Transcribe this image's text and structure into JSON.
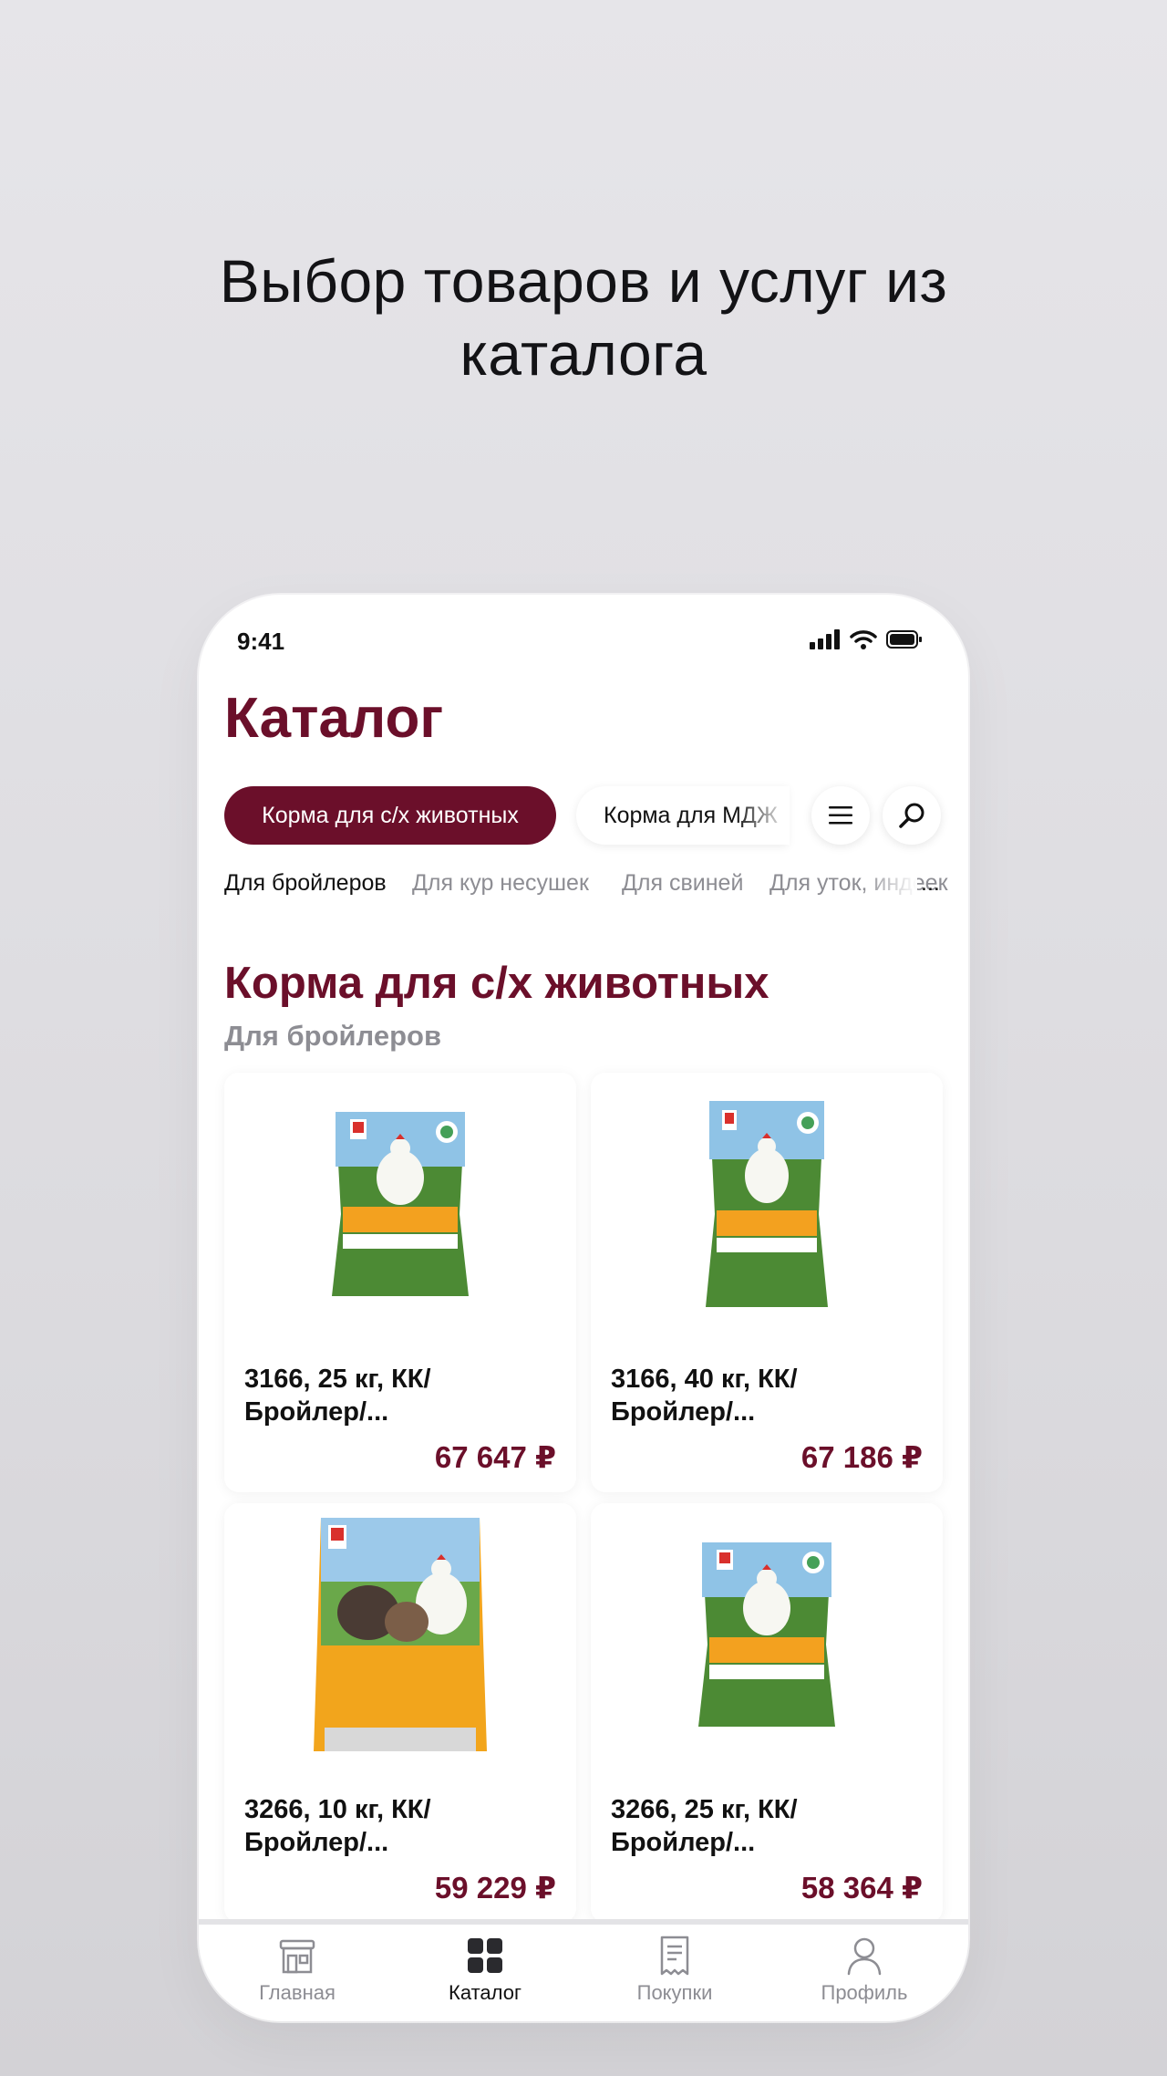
{
  "promo": {
    "line1": "Выбор товаров и услуг из",
    "line2": "каталога"
  },
  "status": {
    "time": "9:41"
  },
  "header": {
    "title": "Каталог"
  },
  "categories": {
    "active": "Корма для с/х животных",
    "next": "Корма для МДЖ"
  },
  "subcategories": {
    "items": [
      "Для бройлеров",
      "Для кур несушек",
      "Для свиней",
      "Для уток, индеек"
    ],
    "more": "..."
  },
  "section": {
    "title": "Корма для с/х животных",
    "subtitle": "Для бройлеров"
  },
  "products": [
    {
      "name_line1": "3166, 25 кг, КК/",
      "name_line2": "Бройлер/...",
      "price": "67 647 ₽"
    },
    {
      "name_line1": "3166, 40 кг, КК/",
      "name_line2": "Бройлер/...",
      "price": "67 186 ₽"
    },
    {
      "name_line1": "3266, 10 кг, КК/",
      "name_line2": "Бройлер/...",
      "price": "59 229 ₽"
    },
    {
      "name_line1": "3266, 25 кг, КК/",
      "name_line2": "Бройлер/...",
      "price": "58 364 ₽"
    }
  ],
  "tabbar": {
    "items": [
      {
        "label": "Главная",
        "icon": "store-icon"
      },
      {
        "label": "Каталог",
        "icon": "grid-icon"
      },
      {
        "label": "Покупки",
        "icon": "receipt-icon"
      },
      {
        "label": "Профиль",
        "icon": "user-icon"
      }
    ],
    "active_index": 1
  },
  "colors": {
    "brand": "#6b0f2a",
    "muted": "#8d8d93",
    "background": "#e2e1e5"
  }
}
